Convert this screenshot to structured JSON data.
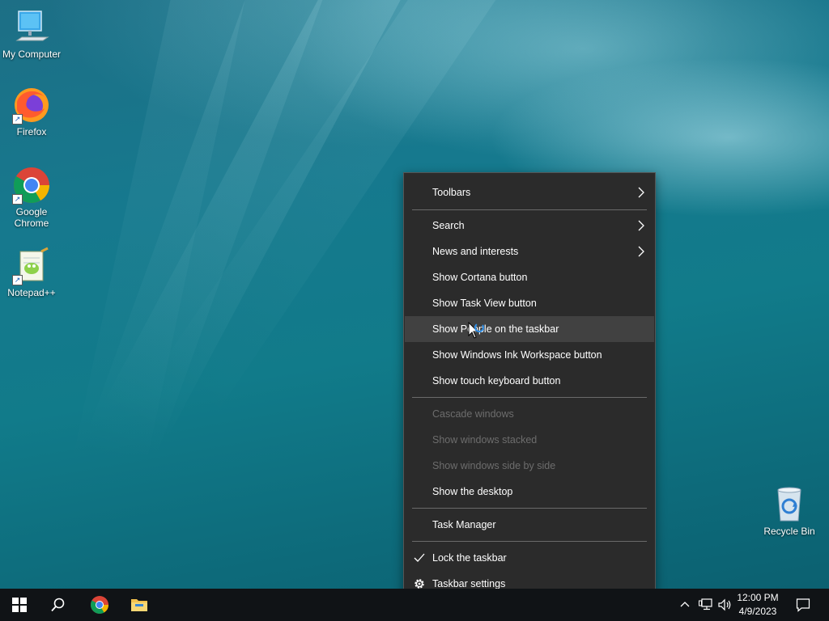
{
  "desktop": {
    "icons": [
      {
        "label": "My Computer",
        "icon": "computer-icon"
      },
      {
        "label": "Firefox",
        "icon": "firefox-icon"
      },
      {
        "label_line1": "Google",
        "label_line2": "Chrome",
        "icon": "chrome-icon"
      },
      {
        "label": "Notepad++",
        "icon": "notepadpp-icon"
      },
      {
        "label": "Recycle Bin",
        "icon": "recycle-bin-icon"
      }
    ]
  },
  "context_menu": {
    "items": [
      {
        "label": "Toolbars",
        "submenu": true
      },
      {
        "label": "Search",
        "submenu": true
      },
      {
        "label": "News and interests",
        "submenu": true
      },
      {
        "label": "Show Cortana button"
      },
      {
        "label": "Show Task View button"
      },
      {
        "label": "Show People on the taskbar",
        "hovered": true
      },
      {
        "label": "Show Windows Ink Workspace button"
      },
      {
        "label": "Show touch keyboard button"
      },
      {
        "label": "Cascade windows",
        "disabled": true
      },
      {
        "label": "Show windows stacked",
        "disabled": true
      },
      {
        "label": "Show windows side by side",
        "disabled": true
      },
      {
        "label": "Show the desktop"
      },
      {
        "label": "Task Manager"
      },
      {
        "label": "Lock the taskbar",
        "checked": true
      },
      {
        "label": "Taskbar settings",
        "icon": "gear-icon"
      }
    ]
  },
  "taskbar": {
    "buttons": [
      "windows-start-icon",
      "search-icon",
      "chrome-icon",
      "file-explorer-icon"
    ],
    "tray_icons": [
      "chevron-up-icon",
      "network-icon",
      "volume-icon"
    ],
    "time": "12:00 PM",
    "date": "4/9/2023",
    "notification_icon": "action-center-icon"
  },
  "colors": {
    "menu_bg": "#2b2b2b",
    "menu_hover": "#414141",
    "menu_disabled_text": "#6d6d6d",
    "taskbar_bg": "#101316"
  }
}
